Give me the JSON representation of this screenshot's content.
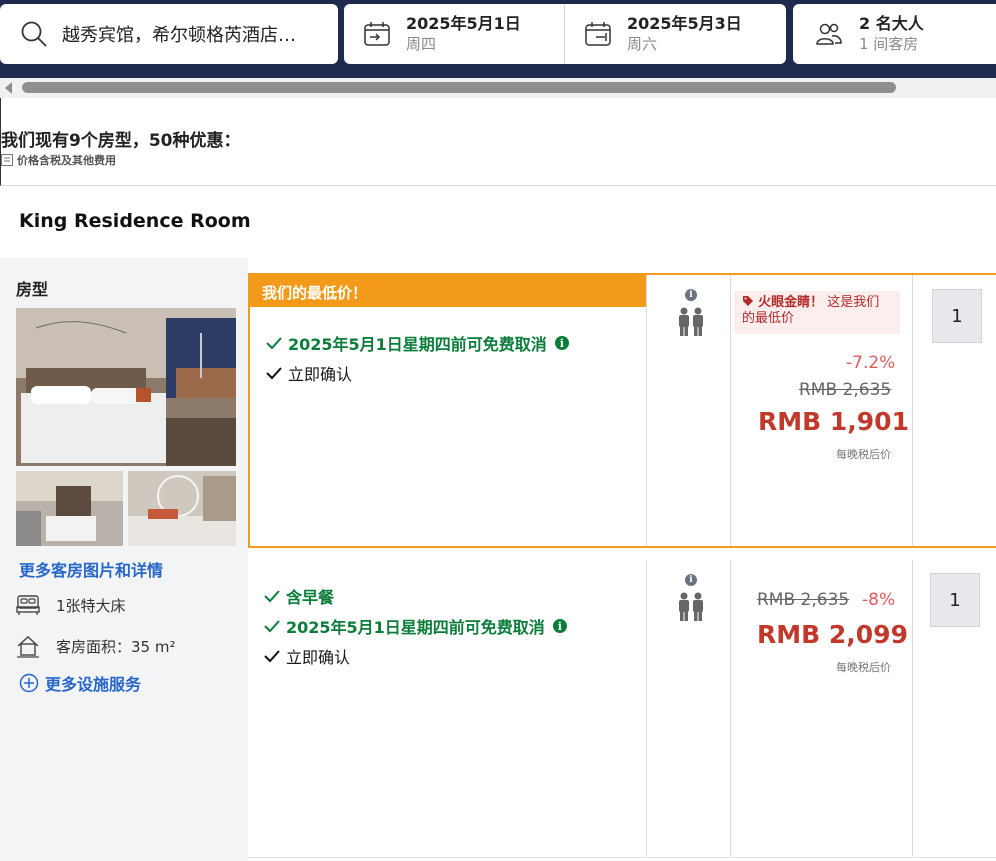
{
  "search": {
    "destination": "越秀宾馆，希尔顿格芮酒店，广州",
    "checkin_date": "2025年5月1日",
    "checkin_weekday": "周四",
    "checkout_date": "2025年5月3日",
    "checkout_weekday": "周六",
    "guests": "2 名大人",
    "rooms": "1 间客房"
  },
  "summary": {
    "title": "我们现有9个房型，50种优惠：",
    "tax_note": "价格含税及其他费用"
  },
  "room": {
    "name": "King Residence Room",
    "type_label": "房型",
    "more_photos": "更多客房图片和详情",
    "bed": "1张特大床",
    "area": "客房面积：35 m²",
    "more_facilities": "更多设施服务"
  },
  "offers": [
    {
      "banner": "我们的最低价！",
      "conditions": [
        "2025年5月1日星期四前可免费取消"
      ],
      "instant": "立即确认",
      "info": "i",
      "deal_title": "火眼金睛！",
      "deal_text": "这是我们的最低价",
      "discount": "-7.2%",
      "old_price": "RMB 2,635",
      "price": "RMB 1,901",
      "per_night": "每晚税后价",
      "qty": "1"
    },
    {
      "conditions": [
        "含早餐",
        "2025年5月1日星期四前可免费取消"
      ],
      "instant": "立即确认",
      "info": "i",
      "discount": "-8%",
      "old_price": "RMB 2,635",
      "price": "RMB 2,099",
      "per_night": "每晚税后价",
      "qty": "1"
    }
  ],
  "colors": {
    "topbar": "#1f2a4e",
    "banner": "#f49a1b",
    "green": "#0a7d3a",
    "price_red": "#c0392b",
    "link_blue": "#2767c9"
  },
  "icons": [
    "search-icon",
    "calendar-in-icon",
    "calendar-out-icon",
    "guests-icon",
    "bed-icon",
    "area-icon",
    "plus-circle-icon",
    "check-icon",
    "info-icon",
    "person-icon",
    "tag-icon"
  ]
}
